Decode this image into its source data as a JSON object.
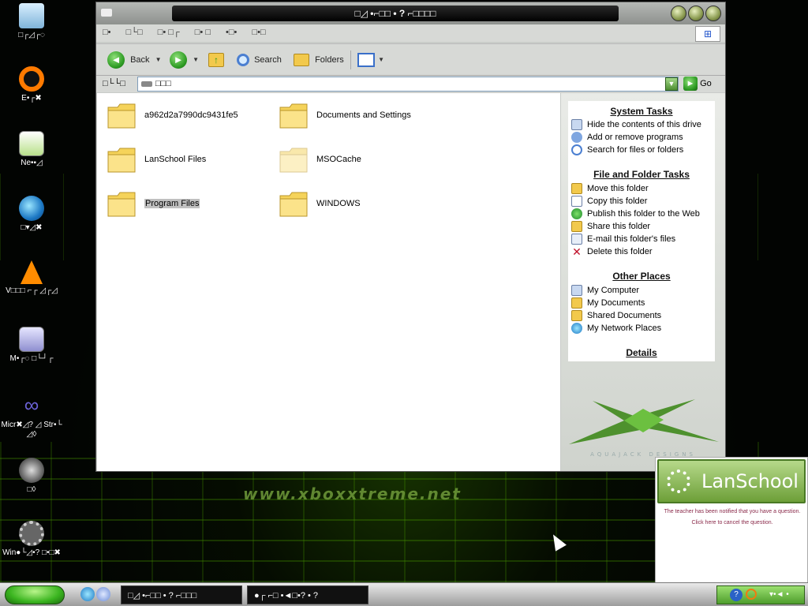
{
  "desktop": {
    "watermark": "www.xboxxtreme.net",
    "icons": [
      {
        "label": "□┌◿┌◌"
      },
      {
        "label": "E•┌✖"
      },
      {
        "label": "Ne•▪◿"
      },
      {
        "label": "□▾◿✖"
      },
      {
        "label": "V□□□ ⌐┌ ◿┌◿"
      },
      {
        "label": "M•┌◌ □└┘┌"
      },
      {
        "label": "Micr✖◿? ◿ Str•└ ◿◊"
      },
      {
        "label": "□◊"
      },
      {
        "label": "Win●└◿•? □•□✖"
      }
    ]
  },
  "window": {
    "title": "□◿ •⌐□□ • ? ⌐□□□□",
    "menu": [
      "□•",
      "□└□",
      "□• □┌",
      "□• □",
      "•□•",
      "□•□"
    ],
    "toolbar": {
      "back_label": "Back",
      "search_label": "Search",
      "folders_label": "Folders"
    },
    "address": {
      "label": "□└└□",
      "value": "□□□",
      "go_label": "Go"
    },
    "folders": [
      {
        "name": "a962d2a7990dc9431fe5",
        "faded": false,
        "selected": false
      },
      {
        "name": "Documents and Settings",
        "faded": false,
        "selected": false
      },
      {
        "name": "LanSchool Files",
        "faded": false,
        "selected": false
      },
      {
        "name": "MSOCache",
        "faded": true,
        "selected": false
      },
      {
        "name": "Program Files",
        "faded": false,
        "selected": true
      },
      {
        "name": "WINDOWS",
        "faded": false,
        "selected": false
      }
    ],
    "task_pane": {
      "system_tasks": {
        "title": "System Tasks",
        "items": [
          "Hide the contents of this drive",
          "Add or remove programs",
          "Search for files or folders"
        ]
      },
      "file_folder_tasks": {
        "title": "File and Folder Tasks",
        "items": [
          "Move this folder",
          "Copy this folder",
          "Publish this folder to the Web",
          "Share this folder",
          "E-mail this folder's files",
          "Delete this folder"
        ]
      },
      "other_places": {
        "title": "Other Places",
        "items": [
          "My Computer",
          "My Documents",
          "Shared Documents",
          "My Network Places"
        ]
      },
      "details": {
        "title": "Details"
      },
      "brand_text": "AQUAJACK DESIGNS"
    }
  },
  "lanschool": {
    "title": "LanSchool",
    "message": "The teacher has been notified that you have a question. Click here to cancel the question."
  },
  "taskbar": {
    "tasks": [
      {
        "label": "□◿ •⌐□□ • ? ⌐□□□"
      },
      {
        "label": "●┌ ⌐□ •◄□•? • ?"
      }
    ],
    "tray_text": "▾•◄ •"
  },
  "colors": {
    "accent_green": "#4e9d2c",
    "folder_yellow": "#f5d35a",
    "title_black": "#000000"
  }
}
